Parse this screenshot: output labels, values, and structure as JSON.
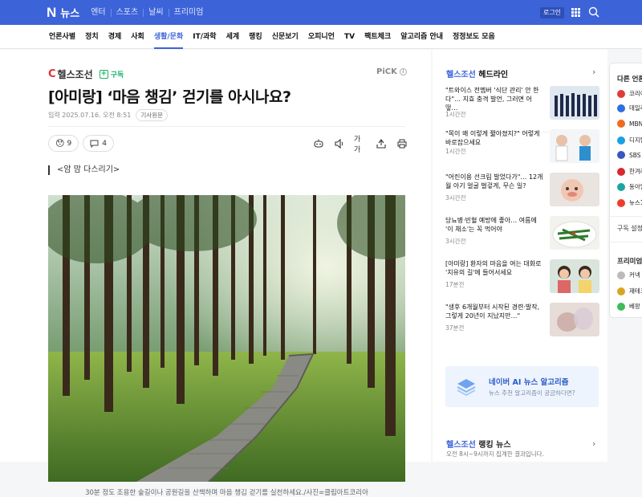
{
  "topbar": {
    "logo_n": "N",
    "logo_text": "뉴스",
    "nav": [
      "엔터",
      "스포츠",
      "날씨",
      "프리미엄"
    ],
    "login": "로그인"
  },
  "categories": [
    "언론사별",
    "정치",
    "경제",
    "사회",
    "생활/문화",
    "IT/과학",
    "세계",
    "랭킹",
    "신문보기",
    "오피니언",
    "TV",
    "팩트체크",
    "알고리즘 안내",
    "정정보도 모음"
  ],
  "active_category": "생활/문화",
  "article": {
    "press": "헬스조선",
    "subscribe": "구독",
    "pick": "PiCK",
    "title": "[아미랑] ‘마음 챙김’ 걷기를 아시나요?",
    "date": "입력 2025.07.16. 오전 8:51",
    "original": "기사원문",
    "reaction_count": "9",
    "comment_count": "4",
    "font_tool": "가가",
    "subheading": "<암 맘 다스리기>",
    "caption": "30분 정도 조용한 숲길이나 공원길을 산책하며 마음 챙김 걷기를 실천하세요./사진=클립아트코리아"
  },
  "side": {
    "press": "헬스조선",
    "heading": "헤드라인",
    "news": [
      {
        "text": "\"트와이스 전멤버 '식단 관리' 안 한다\"… 지효 충격 발언, 그러면 어떻…",
        "time": "1시간전"
      },
      {
        "text": "\"목이 왜 이렇게 짧아졌지?\" 어렇게 바로잡으세요",
        "time": "1시간전"
      },
      {
        "text": "\"어린이용 선크림 발었다가\"… 12개월 아기 얼굴 벌겋게, 무슨 일?",
        "time": "3시간전"
      },
      {
        "text": "당뇨병·빈혈 예방에 좋아… 여름에 '이 채소'는 꼭 먹어야",
        "time": "3시간전"
      },
      {
        "text": "[아미랑] 환자의 마음을 여는 대화로 '치유의 길'에 들어서세요",
        "time": "17분전"
      },
      {
        "text": "\"생후 6개월부터 시작된 경련·발작, 그렇게 20년이 지났지만…\"",
        "time": "37분전"
      }
    ],
    "ai_title": "네이버 AI 뉴스 알고리즘",
    "ai_sub": "뉴스 추천 알고리즘이 궁금하다면?",
    "rank_press": "헬스조선",
    "rank_heading": "랭킹 뉴스",
    "rank_sub": "오전 8시~9시까지 집계한 결과입니다."
  },
  "right": {
    "heading": "다른 언론사",
    "items": [
      {
        "label": "코리아",
        "color": "#e03b3b"
      },
      {
        "label": "데일리",
        "color": "#2c6fe0"
      },
      {
        "label": "MBN",
        "color": "#f06a1e"
      },
      {
        "label": "디지털",
        "color": "#1aa0e6"
      },
      {
        "label": "SBS",
        "color": "#3a57c0"
      },
      {
        "label": "한겨레",
        "color": "#d9282f"
      },
      {
        "label": "동아일",
        "color": "#18a7a0"
      },
      {
        "label": "뉴스1",
        "color": "#ef3b2c"
      }
    ],
    "subset": "구독 설정",
    "heading2": "프리미엄",
    "items2": [
      {
        "label": "커넥",
        "color": "#bbbbbb"
      },
      {
        "label": "재테크",
        "color": "#d9a521"
      },
      {
        "label": "베팡",
        "color": "#3ebd5a"
      }
    ]
  }
}
